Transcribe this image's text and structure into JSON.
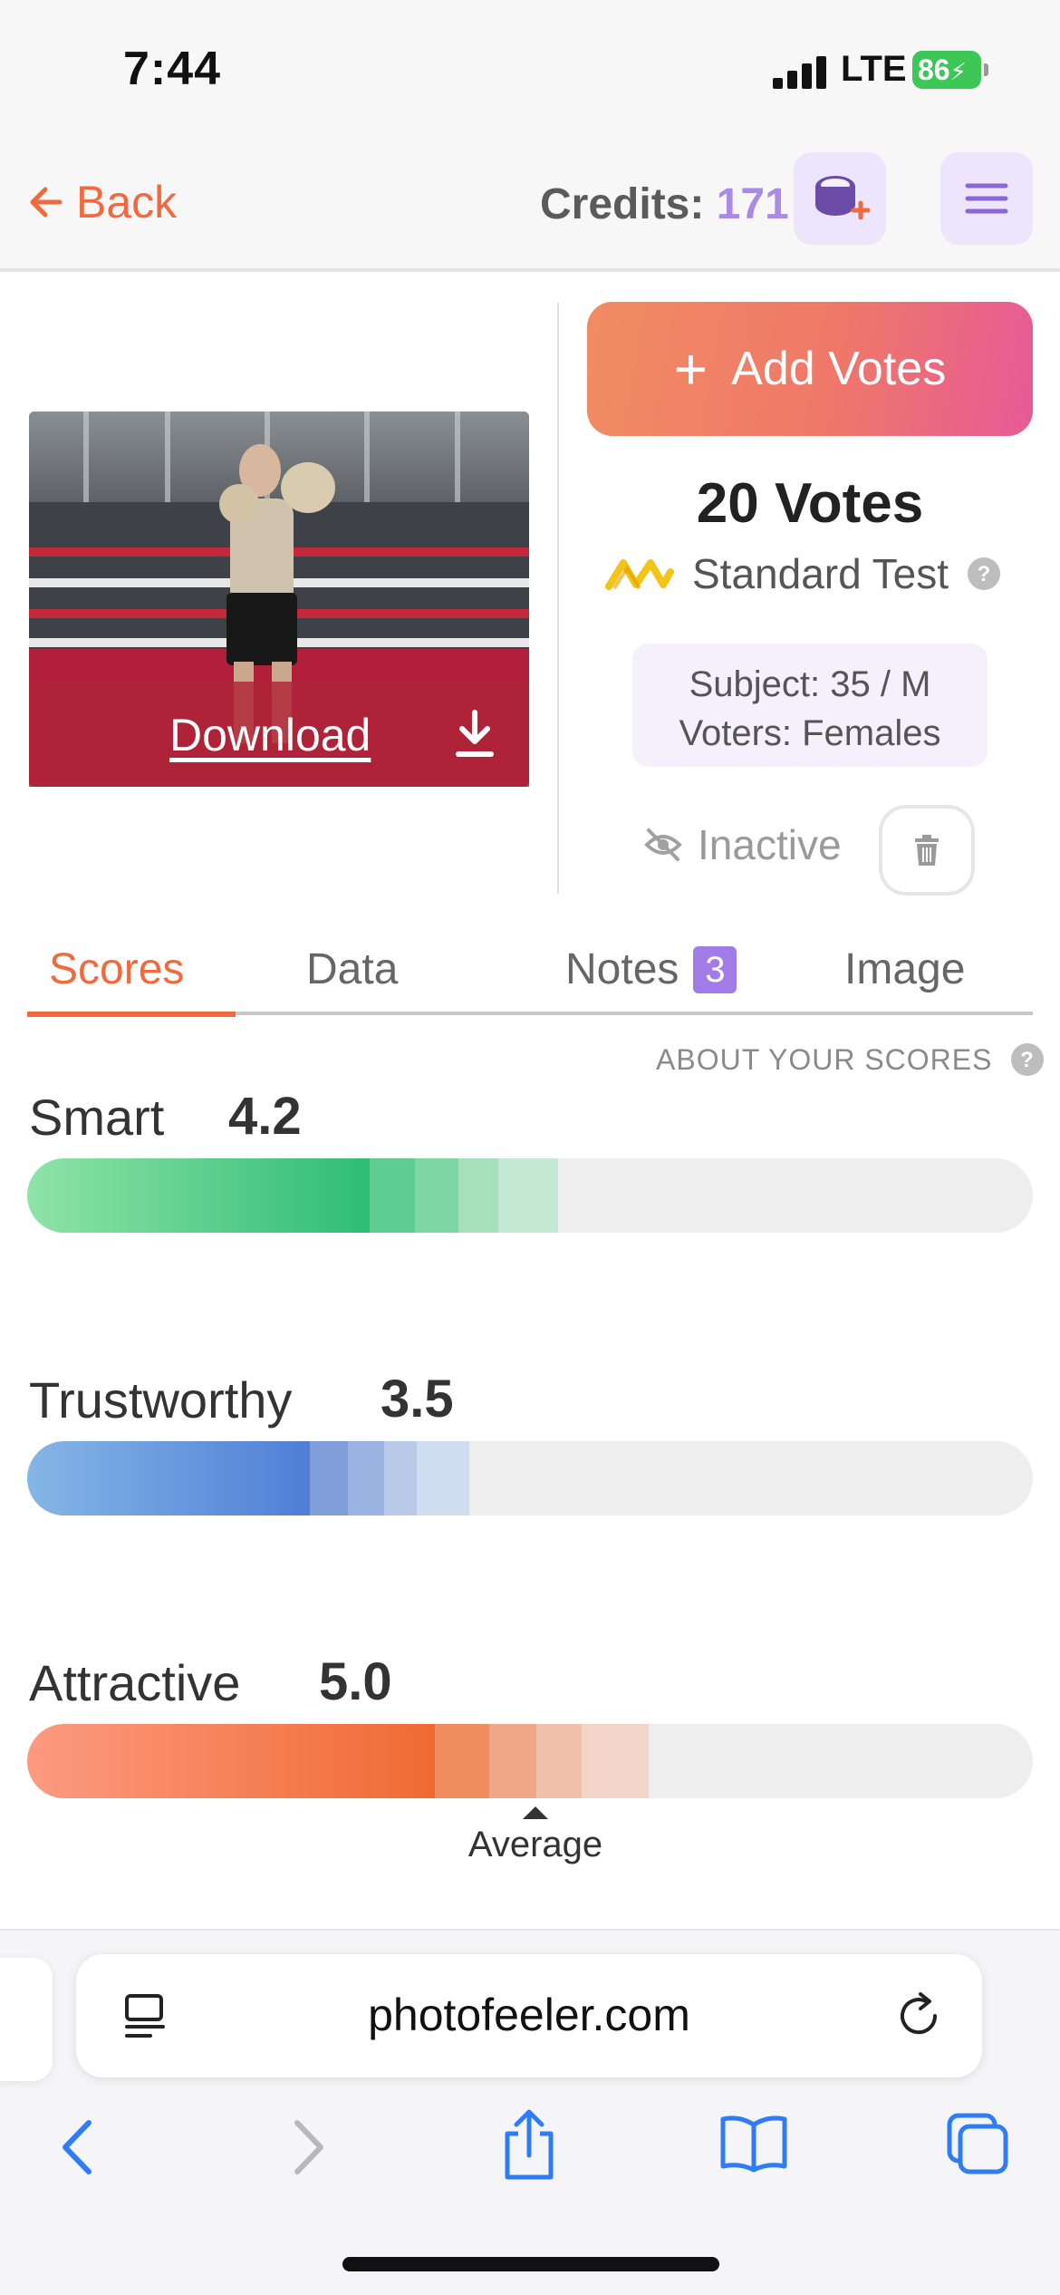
{
  "status_bar": {
    "time": "7:44",
    "network": "LTE",
    "battery": "86"
  },
  "header": {
    "back_label": "Back",
    "credits_label": "Credits: ",
    "credits_value": "171"
  },
  "photo": {
    "download_label": "Download"
  },
  "test": {
    "add_votes_label": "Add Votes",
    "votes": "20 Votes",
    "test_type": "Standard Test",
    "subject": "Subject: 35 / M",
    "voters": "Voters: Females",
    "status": "Inactive"
  },
  "tabs": {
    "scores": "Scores",
    "data": "Data",
    "notes": "Notes",
    "notes_count": "3",
    "image": "Image"
  },
  "about_scores": "ABOUT YOUR SCORES",
  "scores": [
    {
      "label": "Smart",
      "value": "4.2",
      "color": "#3cc07a"
    },
    {
      "label": "Trustworthy",
      "value": "3.5",
      "color": "#5b87d8"
    },
    {
      "label": "Attractive",
      "value": "5.0",
      "color": "#f06a3a"
    }
  ],
  "average_label": "Average",
  "browser": {
    "url": "photofeeler.com"
  },
  "colors": {
    "accent": "#f0693f",
    "purple": "#a98ae6"
  }
}
